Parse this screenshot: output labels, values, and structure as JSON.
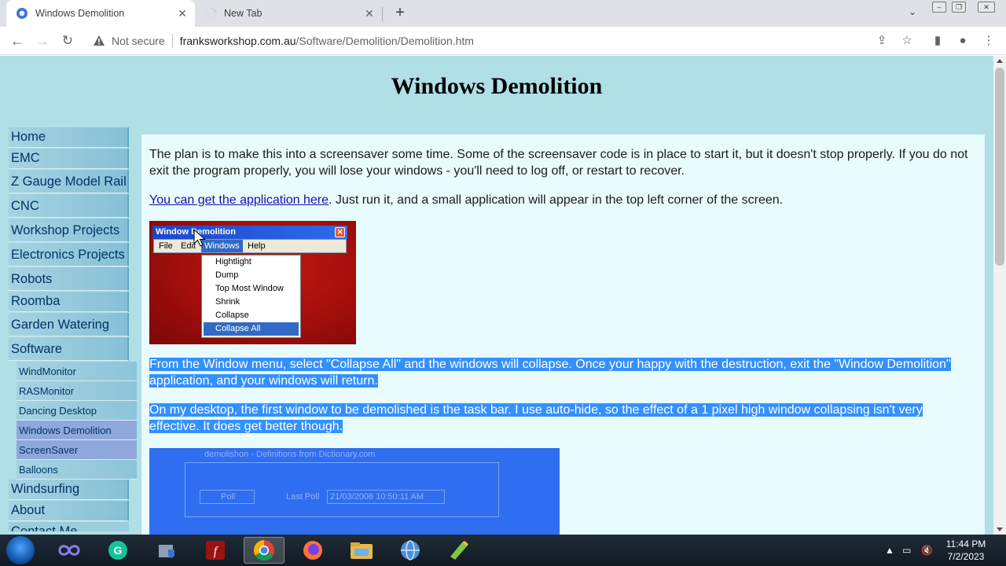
{
  "browser": {
    "tabs": [
      {
        "title": "Windows Demolition",
        "active": true
      },
      {
        "title": "New Tab",
        "active": false
      }
    ],
    "new_tab_label": "+",
    "address": {
      "security_label": "Not secure",
      "host": "franksworkshop.com.au",
      "path": "/Software/Demolition/Demolition.htm"
    }
  },
  "page": {
    "title": "Windows Demolition",
    "nav": {
      "main_items": [
        "Home",
        "EMC",
        "Z Gauge Model Rail",
        "CNC",
        "Workshop Projects",
        "Electronics Projects",
        "Robots",
        "Roomba",
        "Garden Watering",
        "Software"
      ],
      "sub_items": [
        "WindMonitor",
        "RASMonitor",
        "Dancing Desktop",
        "Windows Demolition",
        "ScreenSaver",
        "Balloons"
      ],
      "current_sub": "Windows Demolition",
      "after_items": [
        "Windsurfing",
        "About",
        "Contact Me"
      ]
    },
    "intro": "The plan is to make this into a screensaver some time. Some of the screensaver code is in place to start it, but it doesn't stop properly. If you do not exit the program properly, you will lose your windows - you'll need to log off, or restart to recover.",
    "download_link": "You can get the application here",
    "download_rest": ". Just run it, and a small application will appear in the top left corner of the screen.",
    "screenshot1": {
      "window_title": "Window Demolition",
      "menus": [
        "File",
        "Edit",
        "Windows",
        "Help"
      ],
      "dropdown": [
        "Hightlight",
        "Dump",
        "Top Most Window",
        "Shrink",
        "Collapse",
        "Collapse All"
      ],
      "selected": "Collapse All"
    },
    "para_collapse_1": "From the Window menu, select \"Collapse All\" and the windows will collapse.  Once your happy with the destruction, exit the \"Window Demolition\"",
    "para_collapse_2": "application, and your windows will return.",
    "para_desktop_1": "On my desktop, the first window to be demolished is the task bar.  I use auto-hide, so the effect of a 1 pixel high window collapsing isn't very",
    "para_desktop_2": "effective.  It does get better though.",
    "screenshot2": {
      "caption": "demolishon - Definitions from Dictionary.com",
      "button": "Poll",
      "last_poll_label": "Last Poll",
      "last_poll_value": "21/03/2008 10:50:11 AM"
    }
  },
  "taskbar": {
    "clock_time": "11:44 PM",
    "clock_date": "7/2/2023"
  },
  "colors": {
    "page_bg": "#b0dfe5",
    "content_bg": "#e8fcfd",
    "selection": "#3390ff",
    "link": "#1a0dab"
  }
}
